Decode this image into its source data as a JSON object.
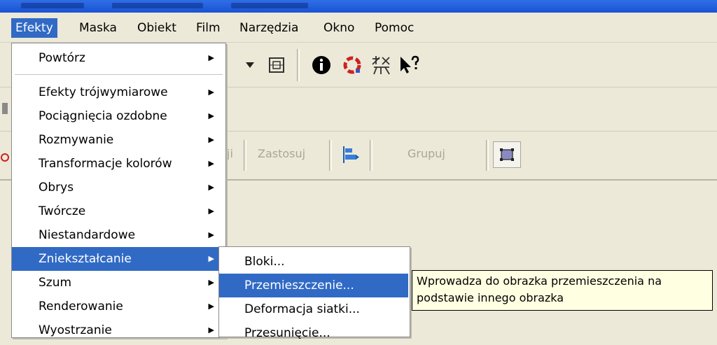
{
  "menubar": {
    "items": [
      "Efekty",
      "Maska",
      "Obiekt",
      "Film",
      "Narzędzia",
      "Okno",
      "Pomoc"
    ],
    "active": "Efekty"
  },
  "toolbar3": {
    "partial_label": "ji",
    "apply_label": "Zastosuj",
    "group_label": "Grupuj"
  },
  "effects_menu": {
    "items": [
      {
        "label": "Powtórz",
        "submenu": true
      },
      {
        "label": "Efekty trójwymiarowe",
        "submenu": true
      },
      {
        "label": "Pociągnięcia ozdobne",
        "submenu": true
      },
      {
        "label": "Rozmywanie",
        "submenu": true
      },
      {
        "label": "Transformacje kolorów",
        "submenu": true
      },
      {
        "label": "Obrys",
        "submenu": true
      },
      {
        "label": "Twórcze",
        "submenu": true
      },
      {
        "label": "Niestandardowe",
        "submenu": true
      },
      {
        "label": "Zniekształcanie",
        "submenu": true,
        "highlighted": true
      },
      {
        "label": "Szum",
        "submenu": true
      },
      {
        "label": "Renderowanie",
        "submenu": true
      },
      {
        "label": "Wyostrzanie",
        "submenu": true
      }
    ]
  },
  "distort_submenu": {
    "items": [
      {
        "label": "Bloki..."
      },
      {
        "label": "Przemieszczenie...",
        "highlighted": true
      },
      {
        "label": "Deformacja siatki..."
      },
      {
        "label": "Przesunięcie..."
      }
    ]
  },
  "tooltip": {
    "line1": "Wprowadza do obrazka przemieszczenia na",
    "line2": "podstawie innego obrazka"
  },
  "colors": {
    "highlight": "#316ac5",
    "titlebar": "#2159d8",
    "tooltip_bg": "#ffffe1",
    "info_icon": "#000000",
    "target_icon": "#cc2222"
  },
  "icons": [
    "dropdown-arrow-icon",
    "fit-frame-icon",
    "info-icon",
    "target-icon",
    "effect-pattern-icon",
    "help-pointer-icon",
    "align-icon",
    "select-frame-icon"
  ]
}
